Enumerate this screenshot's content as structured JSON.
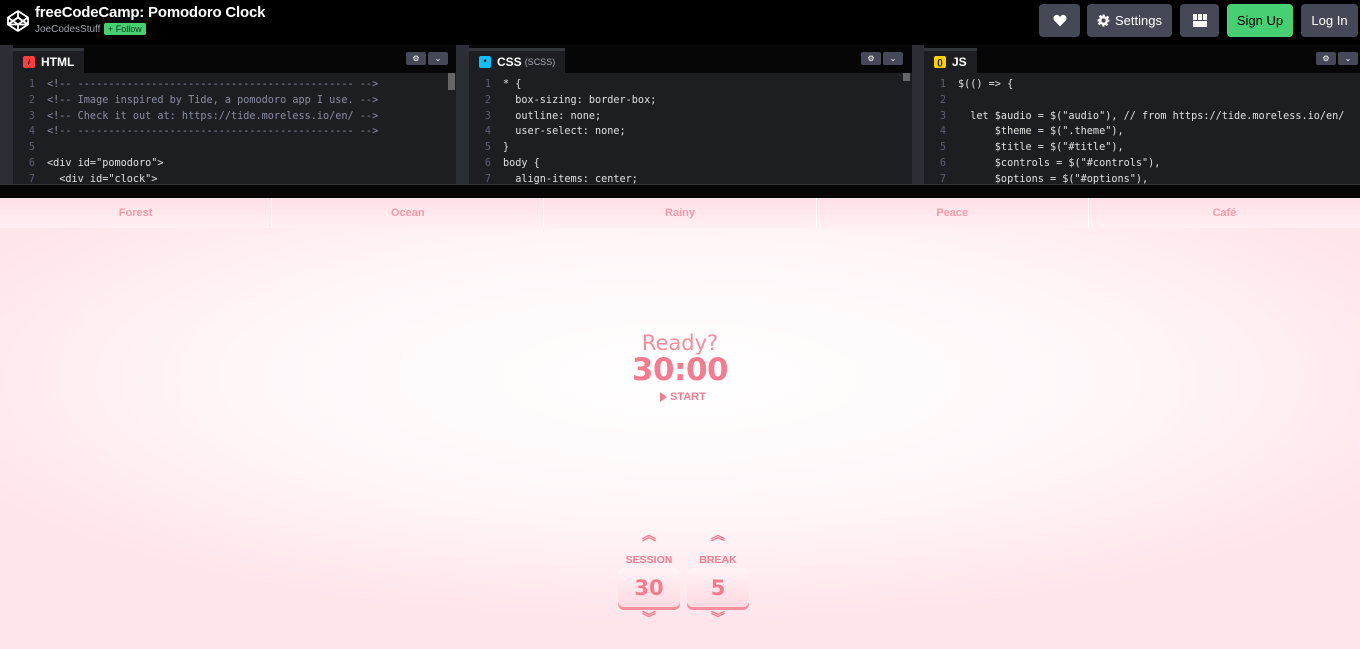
{
  "header": {
    "title": "freeCodeCamp: Pomodoro Clock",
    "author": "JoeCodesStuff",
    "follow_label": "+ Follow",
    "settings_label": "Settings",
    "signup_label": "Sign Up",
    "login_label": "Log In"
  },
  "editors": {
    "html": {
      "label": "HTML",
      "icon_color": "#ff3c41"
    },
    "css": {
      "label": "CSS",
      "sub": "(SCSS)",
      "icon_color": "#0ebeff"
    },
    "js": {
      "label": "JS",
      "icon_color": "#fcd000"
    }
  },
  "html_code": [
    {
      "n": "1",
      "t": "<!-- --------------------------------------------- -->",
      "k": "cm"
    },
    {
      "n": "2",
      "t": "<!-- Image inspired by Tide, a pomodoro app I use. -->",
      "k": "cm"
    },
    {
      "n": "3",
      "t": "<!-- Check it out at: https://tide.moreless.io/en/ -->",
      "k": "cm"
    },
    {
      "n": "4",
      "t": "<!-- --------------------------------------------- -->",
      "k": "cm"
    },
    {
      "n": "5",
      "t": "",
      "k": "pl"
    },
    {
      "n": "6",
      "t": "<div id=\"pomodoro\">",
      "k": "tg"
    },
    {
      "n": "7",
      "t": "  <div id=\"clock\">",
      "k": "tg"
    }
  ],
  "css_code": [
    {
      "n": "1",
      "t": "* {",
      "k": "pl"
    },
    {
      "n": "2",
      "t": "  box-sizing: border-box;",
      "k": "pr"
    },
    {
      "n": "3",
      "t": "  outline: none;",
      "k": "pr"
    },
    {
      "n": "4",
      "t": "  user-select: none;",
      "k": "pr"
    },
    {
      "n": "5",
      "t": "}",
      "k": "pl"
    },
    {
      "n": "6",
      "t": "body {",
      "k": "pl"
    },
    {
      "n": "7",
      "t": "  align-items: center;",
      "k": "pr"
    }
  ],
  "js_code": [
    {
      "n": "1",
      "t": "$(() => {",
      "k": "pl"
    },
    {
      "n": "2",
      "t": "",
      "k": "pl"
    },
    {
      "n": "3",
      "t": "  let $audio = $(\"audio\"), // from https://tide.moreless.io/en/",
      "k": "js"
    },
    {
      "n": "4",
      "t": "      $theme = $(\".theme\"),",
      "k": "js"
    },
    {
      "n": "5",
      "t": "      $title = $(\"#title\"),",
      "k": "js"
    },
    {
      "n": "6",
      "t": "      $controls = $(\"#controls\"),",
      "k": "js"
    },
    {
      "n": "7",
      "t": "      $options = $(\"#options\"),",
      "k": "js"
    }
  ],
  "themes": [
    "Forest",
    "Ocean",
    "Rainy",
    "Peace",
    "Café"
  ],
  "clock": {
    "status": "Ready?",
    "time": "30:00",
    "start_label": "START"
  },
  "session": {
    "label": "SESSION",
    "value": "30"
  },
  "break": {
    "label": "BREAK",
    "value": "5"
  },
  "colors": {
    "accent": "#f77b8e",
    "signup": "#47cf73"
  }
}
